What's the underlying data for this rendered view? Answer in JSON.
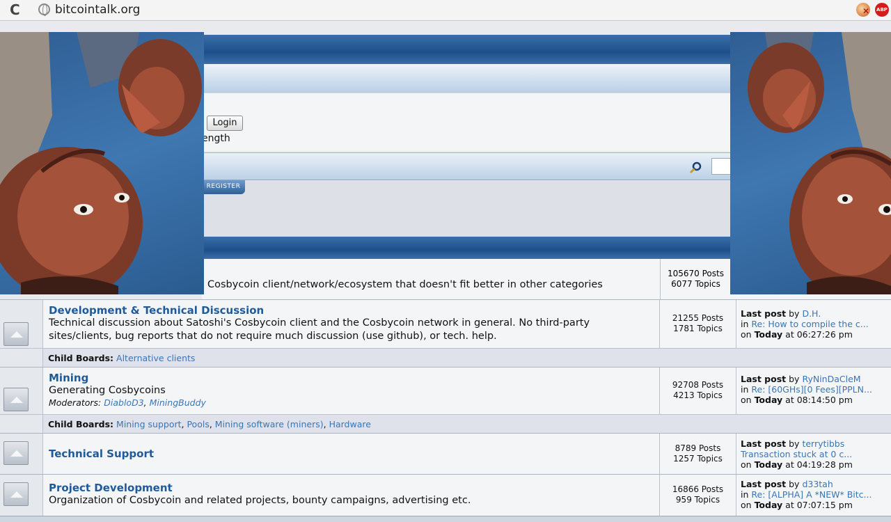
{
  "browser": {
    "url": "bitcointalk.org"
  },
  "header": {
    "login_label": "Login",
    "length_fragment": "ength",
    "register_tab": "REGISTER"
  },
  "top_board": {
    "desc_fragment": "Cosbycoin client/network/ecosystem that doesn't fit better in other categories",
    "posts": "105670 Posts",
    "topics": "6077 Topics"
  },
  "boards": [
    {
      "name": "Development & Technical Discussion",
      "desc": "Technical discussion about Satoshi's Cosbycoin client and the Cosbycoin network in general. No third-party sites/clients, bug reports that do not require much discussion (use github), or tech. help.",
      "posts": "21255 Posts",
      "topics": "1781 Topics",
      "last_post_by": "D.H.",
      "last_post_in": "Re: How to compile the c...",
      "last_post_day": "Today",
      "last_post_time": "at 06:27:26 pm",
      "child_boards": [
        "Alternative clients"
      ]
    },
    {
      "name": "Mining",
      "desc": "Generating Cosbycoins",
      "moderators_label": "Moderators:",
      "moderators": [
        "DiabloD3",
        "MiningBuddy"
      ],
      "posts": "92708 Posts",
      "topics": "4213 Topics",
      "last_post_by": "RyNinDaCleM",
      "last_post_in": "Re: [60GHs][0 Fees][PPLN...",
      "last_post_day": "Today",
      "last_post_time": "at 08:14:50 pm",
      "child_boards": [
        "Mining support",
        "Pools",
        "Mining software (miners)",
        "Hardware"
      ]
    },
    {
      "name": "Technical Support",
      "desc": "",
      "posts": "8789 Posts",
      "topics": "1257 Topics",
      "last_post_by": "terrytibbs",
      "last_post_in": "Transaction stuck at 0 c...",
      "last_post_day": "Today",
      "last_post_time": "at 04:19:28 pm"
    },
    {
      "name": "Project Development",
      "desc": "Organization of Cosbycoin and related projects, bounty campaigns, advertising etc.",
      "posts": "16866 Posts",
      "topics": "959 Topics",
      "last_post_by": "d33tah",
      "last_post_in": "Re: [ALPHA] A *NEW* Bitc...",
      "last_post_day": "Today",
      "last_post_time": "at 07:07:15 pm"
    }
  ],
  "labels": {
    "last_post": "Last post",
    "by": "by",
    "in": "in",
    "on": "on",
    "child_boards": "Child Boards:"
  },
  "colors": {
    "link": "#3a75b3",
    "board_title": "#1f5a9a",
    "header_blue": "#1e4f8b"
  }
}
